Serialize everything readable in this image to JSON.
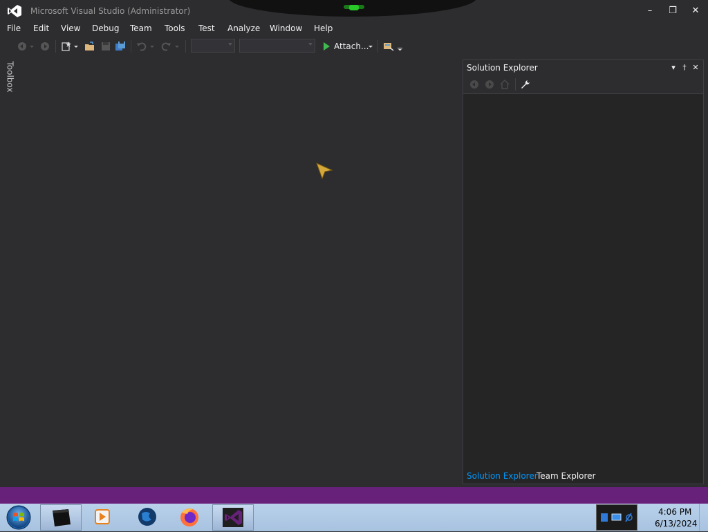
{
  "window": {
    "title": "Microsoft Visual Studio (Administrator)",
    "minimize_label": "–",
    "restore_label": "❐",
    "close_label": "✕"
  },
  "menu": {
    "items": [
      "File",
      "Edit",
      "View",
      "Debug",
      "Team",
      "Tools",
      "Test",
      "Analyze",
      "Window",
      "Help"
    ]
  },
  "toolbar": {
    "attach_label": "Attach...",
    "config_combo_value": "",
    "platform_combo_value": "",
    "icons": [
      "back-icon",
      "forward-icon",
      "new-project-icon",
      "open-file-icon",
      "save-icon",
      "save-all-icon",
      "undo-icon",
      "redo-icon",
      "start-icon",
      "find-icon"
    ]
  },
  "toolbox": {
    "label": "Toolbox"
  },
  "solution_explorer": {
    "title": "Solution Explorer",
    "dropdown_label": "▾",
    "pin_label": "†",
    "close_label": "✕",
    "tools": [
      "back-icon",
      "forward-icon",
      "home-icon",
      "properties-wrench-icon"
    ]
  },
  "bottom_tabs": [
    "Solution Explorer",
    "Team Explorer"
  ],
  "taskbar": {
    "apps": [
      "terminal-app-icon",
      "media-player-icon",
      "globe-browser-icon",
      "firefox-icon",
      "visual-studio-icon"
    ],
    "clock_time": "4:06 PM",
    "clock_date": "6/13/2024"
  },
  "colors": {
    "background": "#2d2d30",
    "accent_blue": "#0097fb",
    "status_purple": "#68217a"
  }
}
